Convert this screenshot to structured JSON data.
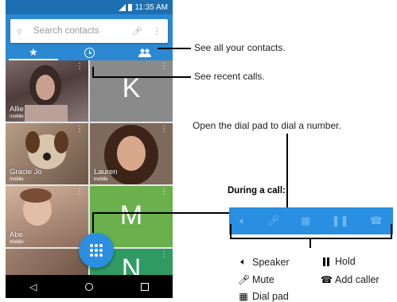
{
  "status_bar": {
    "time": "11:35 AM"
  },
  "search": {
    "placeholder": "Search contacts",
    "search_icon": "search-icon",
    "mic_icon": "mic-icon",
    "more_icon": "more-vert-icon"
  },
  "tabs": [
    {
      "icon": "star-icon",
      "label": "Favorites"
    },
    {
      "icon": "clock-icon",
      "label": "Recents"
    },
    {
      "icon": "people-icon",
      "label": "Contacts"
    }
  ],
  "tiles": [
    {
      "name": "Allie",
      "type": "mobile"
    },
    {
      "letter": "K"
    },
    {
      "name": "Gracie Jo",
      "type": "mobile"
    },
    {
      "name": "Lauren",
      "type": "mobile"
    },
    {
      "name": "Abe",
      "type": "mobile"
    },
    {
      "letter": "M"
    },
    {
      "letter": "N"
    }
  ],
  "callouts": {
    "contacts": "See all your contacts.",
    "recents": "See recent calls.",
    "dialpad": "Open the dial pad to dial a number."
  },
  "during_call": {
    "heading": "During a call:",
    "legend": {
      "speaker": "Speaker",
      "hold": "Hold",
      "mute": "Mute",
      "add_caller": "Add caller",
      "dialpad": "Dial pad"
    }
  },
  "colors": {
    "appbar": "#2b88d3",
    "statusbar": "#1c6fb1",
    "fab": "#2b8ee0",
    "tile_k": "#8a8a8a",
    "tile_green": "#6ab04c"
  }
}
